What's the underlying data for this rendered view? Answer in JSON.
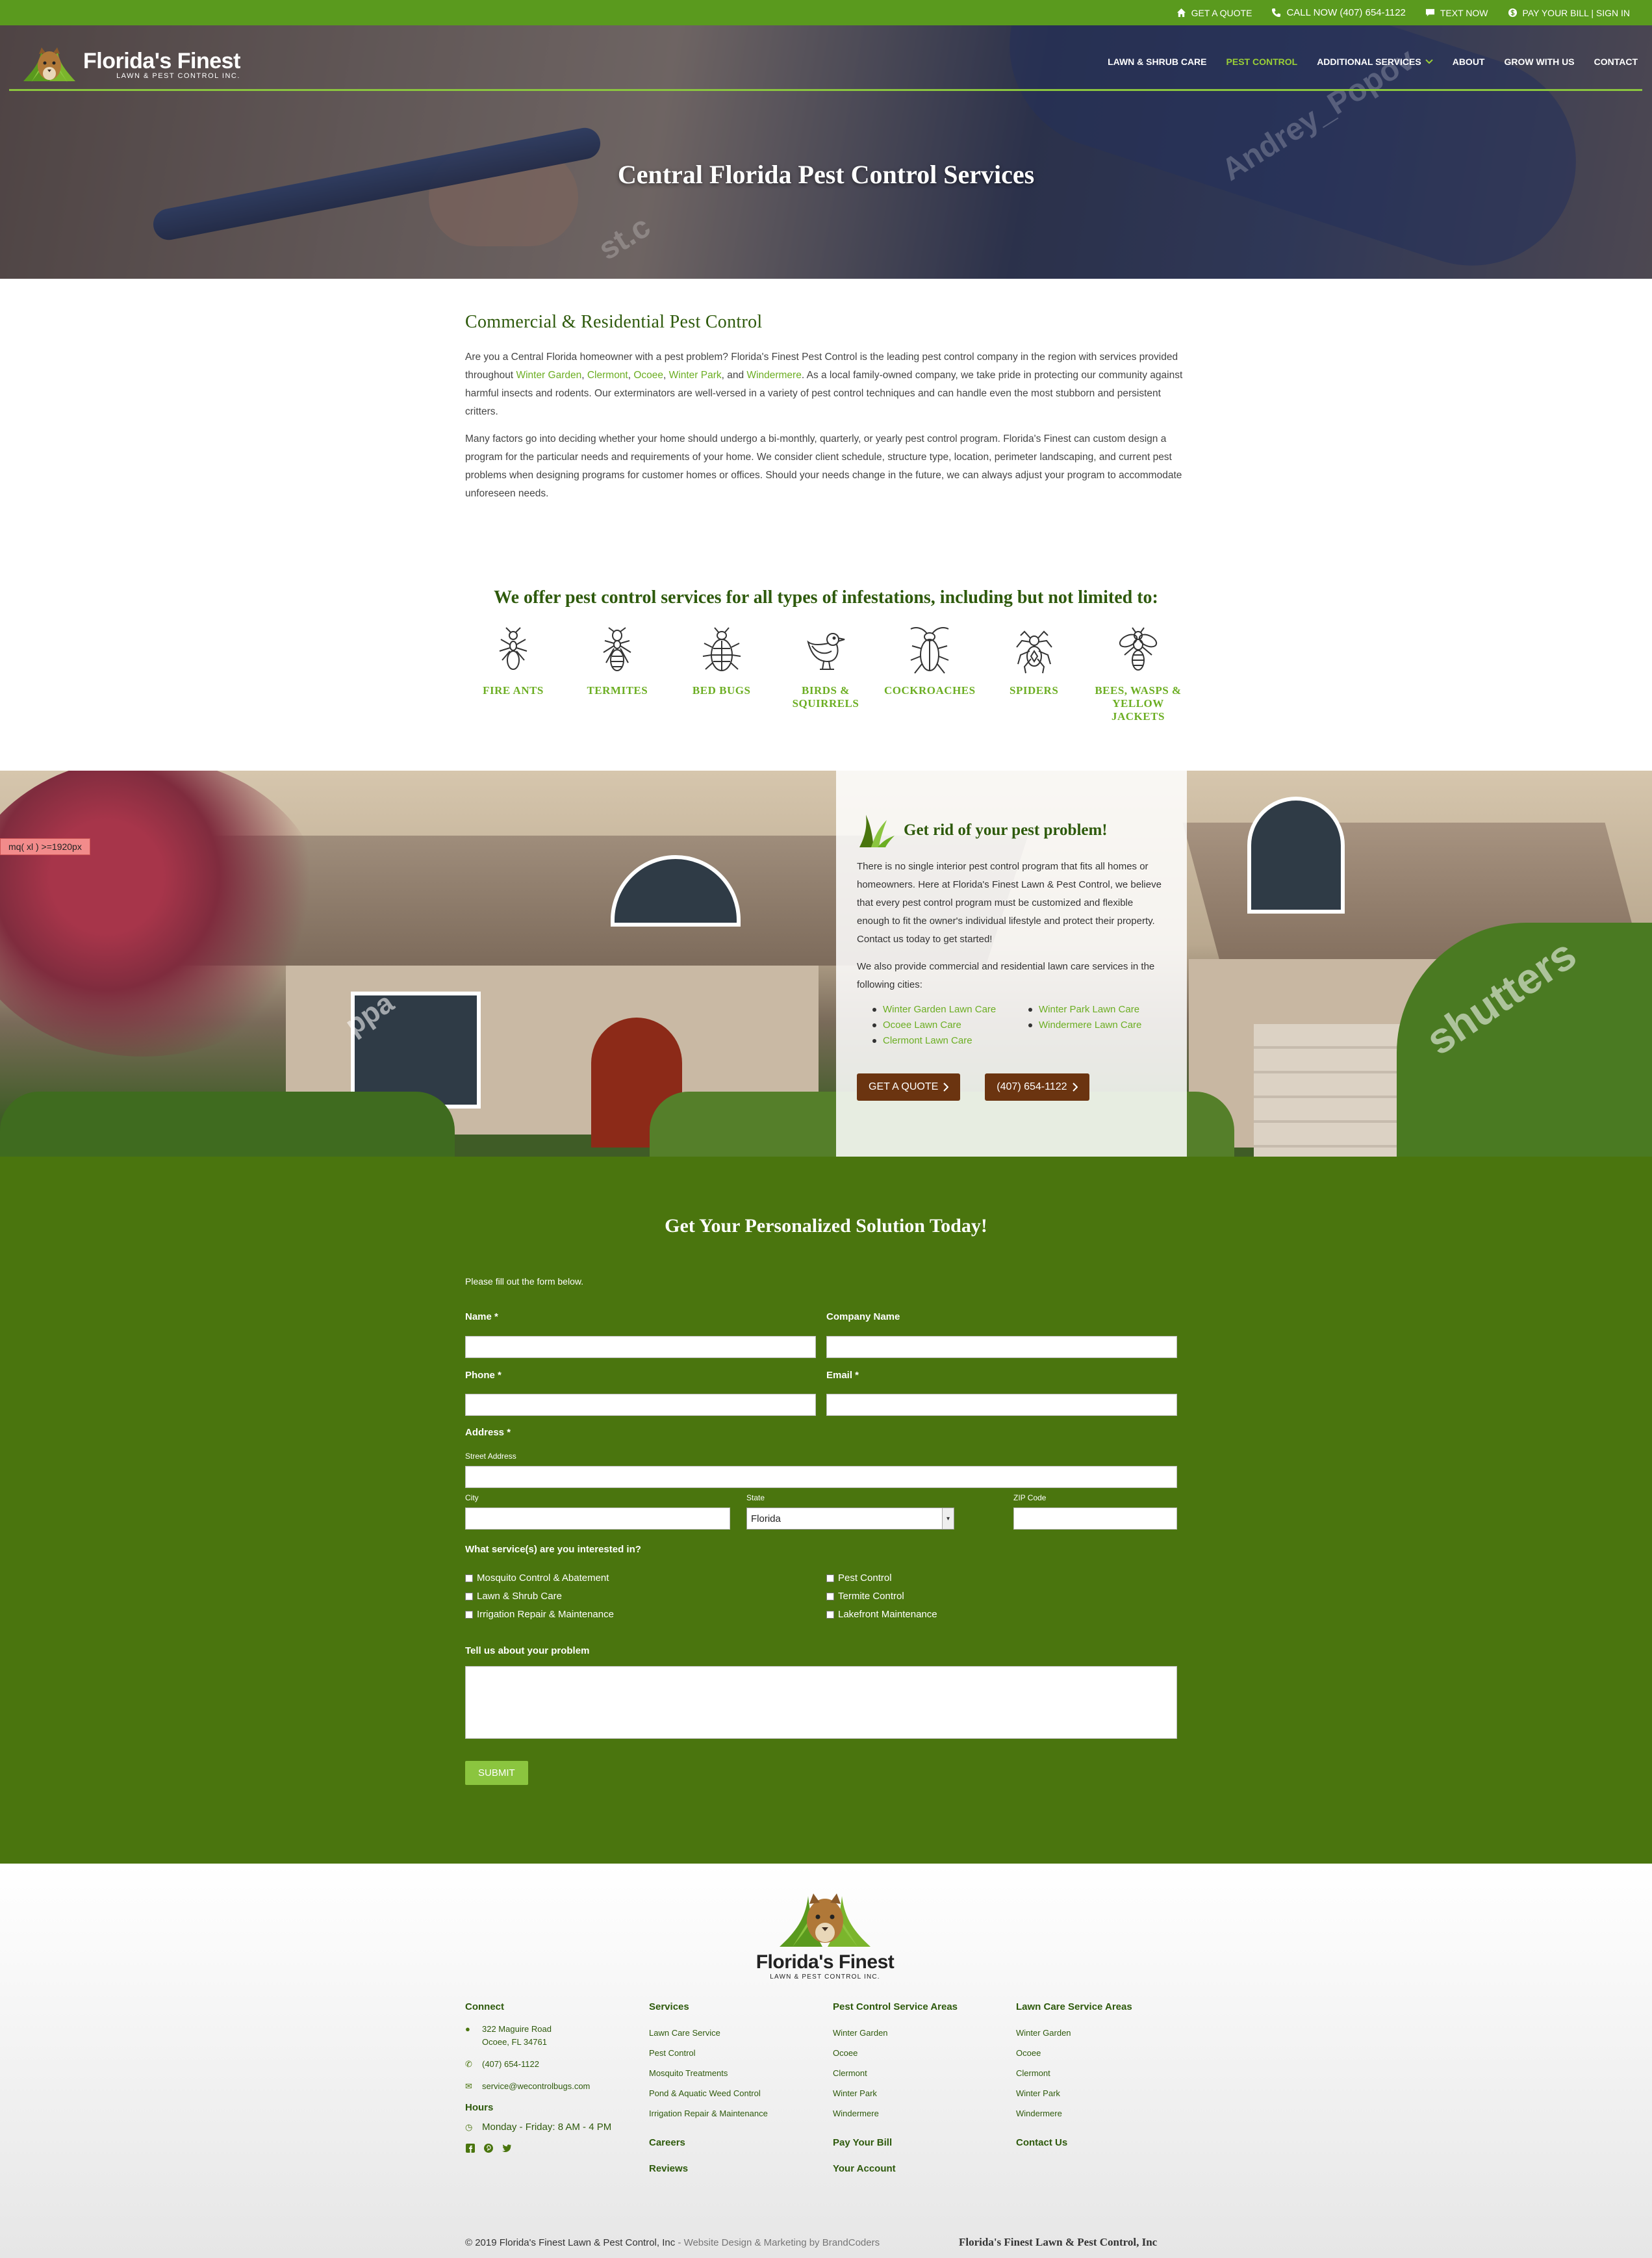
{
  "topbar": {
    "quote": "GET A QUOTE",
    "call": "CALL NOW (407) 654-1122",
    "text": "TEXT NOW",
    "pay": "PAY YOUR BILL | SIGN IN",
    "icons": [
      "home-icon",
      "phone-icon",
      "chat-icon",
      "dollar-icon"
    ]
  },
  "logo": {
    "name": "Florida's Finest",
    "sub": "LAWN & PEST CONTROL INC."
  },
  "nav": {
    "items": [
      "LAWN & SHRUB CARE",
      "PEST CONTROL",
      "ADDITIONAL SERVICES",
      "ABOUT",
      "GROW WITH US",
      "CONTACT"
    ],
    "active": "PEST CONTROL"
  },
  "hero": {
    "title": "Central Florida Pest Control Services",
    "watermark_1": "Andrey_Popov",
    "watermark_2": "st.c"
  },
  "intro": {
    "heading": "Commercial & Residential Pest Control",
    "p1_a": "Are you a Central Florida homeowner with a pest problem? Florida's Finest Pest Control is the leading pest control company in the region with services provided throughout ",
    "city1": "Winter Garden",
    "sep1": ", ",
    "city2": "Clermont",
    "sep2": ", ",
    "city3": "Ocoee",
    "sep3": ", ",
    "city4": "Winter Park",
    "sep4": ", and ",
    "city5": "Windermere",
    "p1_b": ". As a local family-owned company, we take pride in protecting our community against harmful insects and rodents. Our exterminators are well-versed in a variety of pest control techniques and can handle even the most stubborn and persistent critters.",
    "p2": "Many factors go into deciding whether your home should undergo a bi-monthly, quarterly, or yearly pest control program. Florida's Finest can custom design a program for the particular needs and requirements of your home. We consider client schedule, structure type, location, perimeter landscaping, and current pest problems when designing programs for customer homes or offices. Should your needs change in the future, we can always adjust your program to accommodate unforeseen needs."
  },
  "pests": {
    "title": "We offer pest control services for all types of infestations, including but not limited to:",
    "items": [
      {
        "label": "FIRE ANTS",
        "icon": "ant-icon"
      },
      {
        "label": "TERMITES",
        "icon": "termite-icon"
      },
      {
        "label": "BED BUGS",
        "icon": "bedbug-icon"
      },
      {
        "label": "BIRDS & SQUIRRELS",
        "icon": "bird-icon"
      },
      {
        "label": "COCKROACHES",
        "icon": "cockroach-icon"
      },
      {
        "label": "SPIDERS",
        "icon": "spider-icon"
      },
      {
        "label": "BEES, WASPS & YELLOW JACKETS",
        "icon": "bee-icon"
      }
    ]
  },
  "house": {
    "mq": "mq( xl ) >=1920px",
    "watermark_1": "ppa",
    "watermark_2": "shutters"
  },
  "panel": {
    "heading": "Get rid of your pest problem!",
    "p1": "There is no single interior pest control program that fits all homes or homeowners. Here at Florida's Finest Lawn & Pest Control, we believe that every pest control program must be customized and flexible enough to fit the owner's individual lifestyle and protect their property. Contact us today to get started!",
    "p2": "We also provide commercial and residential lawn care services in the following cities:",
    "cities": [
      "Winter Garden Lawn Care",
      "Winter Park Lawn Care",
      "Ocoee Lawn Care",
      "Windermere Lawn Care",
      "Clermont Lawn Care"
    ],
    "btn_quote": "GET A QUOTE",
    "btn_phone": "(407) 654-1122"
  },
  "form": {
    "heading": "Get Your Personalized Solution Today!",
    "note": "Please fill out the form below.",
    "name_label": "Name *",
    "company_label": "Company Name",
    "phone_label": "Phone *",
    "email_label": "Email *",
    "address_label": "Address *",
    "street_label": "Street Address",
    "city_label": "City",
    "state_label": "State",
    "state_value": "Florida",
    "zip_label": "ZIP Code",
    "services_label": "What service(s) are you interested in?",
    "services": [
      "Mosquito Control & Abatement",
      "Pest Control",
      "Lawn & Shrub Care",
      "Termite Control",
      "Irrigation Repair & Maintenance",
      "Lakefront Maintenance"
    ],
    "problem_label": "Tell us about your problem",
    "submit": "SUBMIT"
  },
  "footer": {
    "logo_name": "Florida's Finest",
    "logo_sub": "LAWN & PEST CONTROL INC.",
    "connect": {
      "heading": "Connect",
      "addr1": "322 Maguire Road",
      "addr2": "Ocoee, FL 34761",
      "phone": "(407) 654-1122",
      "email": "service@wecontrolbugs.com",
      "hours_heading": "Hours",
      "hours": "Monday - Friday: 8 AM - 4 PM"
    },
    "services": {
      "heading": "Services",
      "items": [
        "Lawn Care Service",
        "Pest Control",
        "Mosquito Treatments",
        "Pond & Aquatic Weed Control",
        "Irrigation Repair & Maintenance"
      ],
      "careers": "Careers",
      "reviews": "Reviews"
    },
    "pest_areas": {
      "heading": "Pest Control Service Areas",
      "items": [
        "Winter Garden",
        "Ocoee",
        "Clermont",
        "Winter Park",
        "Windermere"
      ],
      "pay": "Pay Your Bill",
      "account": "Your Account"
    },
    "lawn_areas": {
      "heading": "Lawn Care Service Areas",
      "items": [
        "Winter Garden",
        "Ocoee",
        "Clermont",
        "Winter Park",
        "Windermere"
      ],
      "contact": "Contact Us"
    },
    "copyright": "© 2019 Florida's Finest Lawn & Pest Control, Inc",
    "credit": " - Website Design & Marketing by BrandCoders",
    "company": "Florida's Finest Lawn & Pest Control, Inc"
  }
}
